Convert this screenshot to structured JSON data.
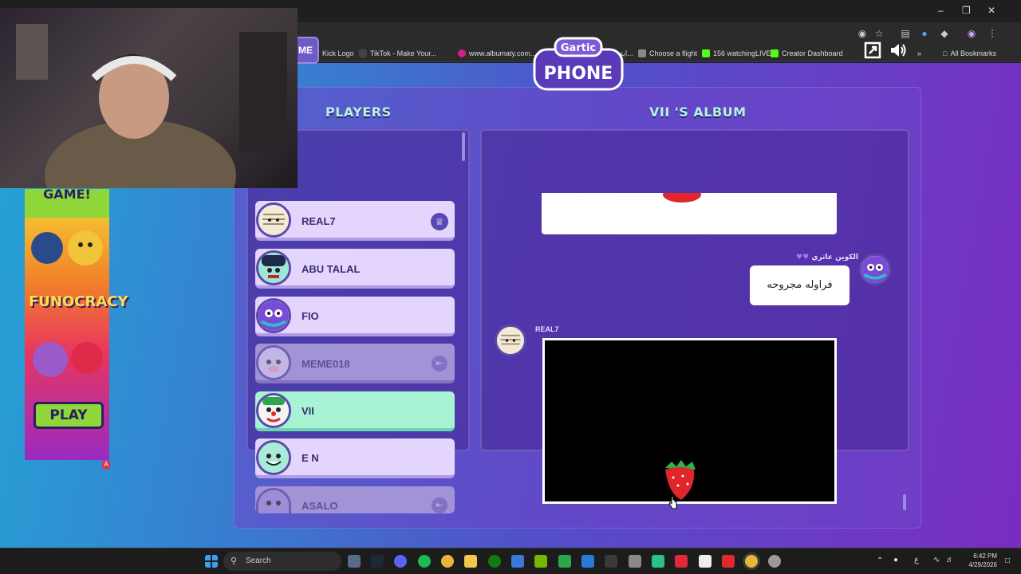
{
  "bookmarks": [
    {
      "label": "Kick Logo",
      "color": "#53fc18"
    },
    {
      "label": "TikTok - Make Your...",
      "color": "#222222"
    },
    {
      "label": "www.albumaty.com...",
      "color": "#d0208a"
    },
    {
      "label": "اية المسؤولية - بحث...",
      "color": "#4285f4"
    },
    {
      "label": "Choose a flight",
      "color": "#888888"
    },
    {
      "label": "156 watchingLIVE",
      "color": "#53fc18"
    },
    {
      "label": "Creator Dashboard",
      "color": "#53fc18"
    }
  ],
  "all_bookmarks": "All Bookmarks",
  "back_button": "ME",
  "logo": {
    "top": "Gartic",
    "bottom": "PHONE"
  },
  "players_title": "PLAYERS",
  "album_title": "VII 'S ALBUM",
  "players": [
    {
      "name": "REAL7",
      "state": "host"
    },
    {
      "name": "ABU TALAL",
      "state": "normal"
    },
    {
      "name": "FIO",
      "state": "normal"
    },
    {
      "name": "MEME018",
      "state": "away"
    },
    {
      "name": "VII",
      "state": "active"
    },
    {
      "name": "E N",
      "state": "normal"
    },
    {
      "name": "ASALO",
      "state": "away"
    }
  ],
  "album": {
    "guess_author": "الكوين عاتري",
    "guess_text": "فراوله مجروحه",
    "drawing_author": "REAL7"
  },
  "ad": {
    "top_text": "GAME!",
    "brand": "FUNOCRACY",
    "play": "PLAY",
    "badge": "A"
  },
  "taskbar": {
    "search": "Search",
    "time": "6:42 PM",
    "date": "4/29/2026",
    "lang": "ع"
  },
  "colors": {
    "accent": "#53fc18",
    "active_row": "#a8f3d4",
    "row": "#e3d5fb"
  }
}
